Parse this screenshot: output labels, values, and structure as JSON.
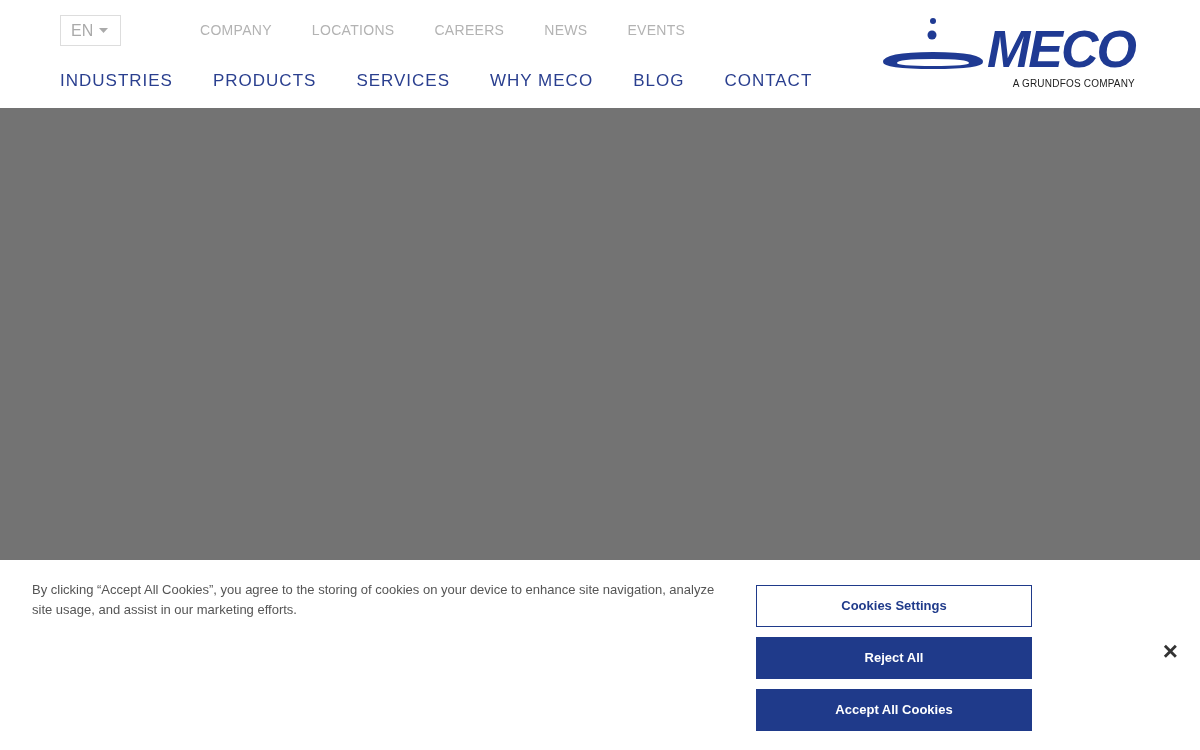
{
  "language": {
    "value": "EN"
  },
  "top_links": [
    "COMPANY",
    "LOCATIONS",
    "CAREERS",
    "NEWS",
    "EVENTS"
  ],
  "main_nav": [
    "INDUSTRIES",
    "PRODUCTS",
    "SERVICES",
    "WHY MECO",
    "BLOG",
    "CONTACT"
  ],
  "logo": {
    "name": "MECO",
    "tagline": "A GRUNDFOS COMPANY"
  },
  "cookie_banner": {
    "text": "By clicking “Accept All Cookies”, you agree to the storing of cookies on your device to enhance site navigation, analyze site usage, and assist in our marketing efforts.",
    "buttons": [
      {
        "label": "Cookies Settings",
        "kind": "outline"
      },
      {
        "label": "Reject All",
        "kind": "solid"
      },
      {
        "label": "Accept All Cookies",
        "kind": "solid"
      }
    ],
    "close": "×"
  }
}
